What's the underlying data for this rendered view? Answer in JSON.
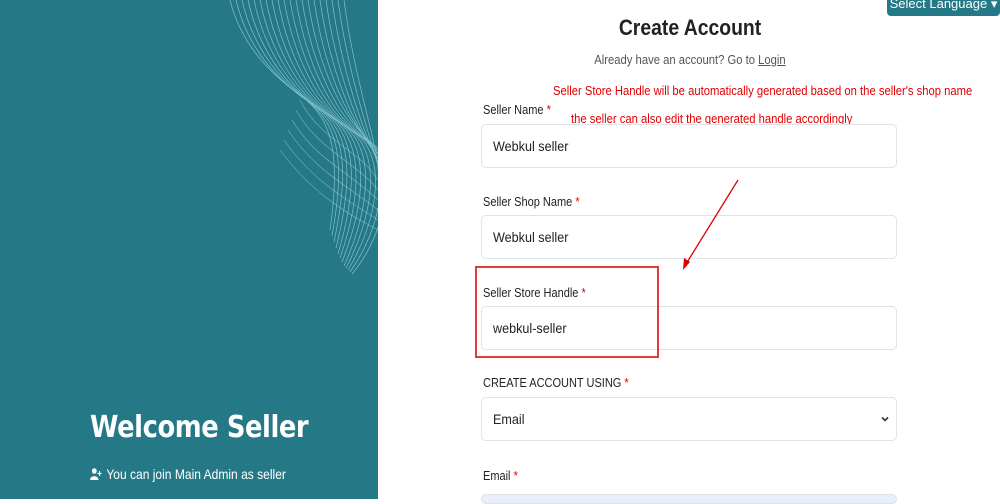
{
  "left_panel": {
    "welcome_title": "Welcome Seller",
    "welcome_sub": "You can join Main Admin as seller",
    "bg_color": "#257987"
  },
  "header": {
    "language_button": "Select Language ▾"
  },
  "form": {
    "title": "Create Account",
    "login_prefix": "Already have an account? Go to",
    "login_link": "Login",
    "annotation_line1": "Seller Store Handle will be automatically generated based on the seller's shop name",
    "annotation_line2": "the seller can also edit the generated handle accordingly",
    "seller_name_label": "Seller Name",
    "seller_name_value": "Webkul seller",
    "shop_name_label": "Seller Shop Name",
    "shop_name_value": "Webkul seller",
    "store_handle_label": "Seller Store Handle",
    "store_handle_value": "webkul-seller",
    "create_using_label": "CREATE ACCOUNT USING",
    "create_using_value": "Email",
    "email_label": "Email",
    "required_mark": "*"
  }
}
